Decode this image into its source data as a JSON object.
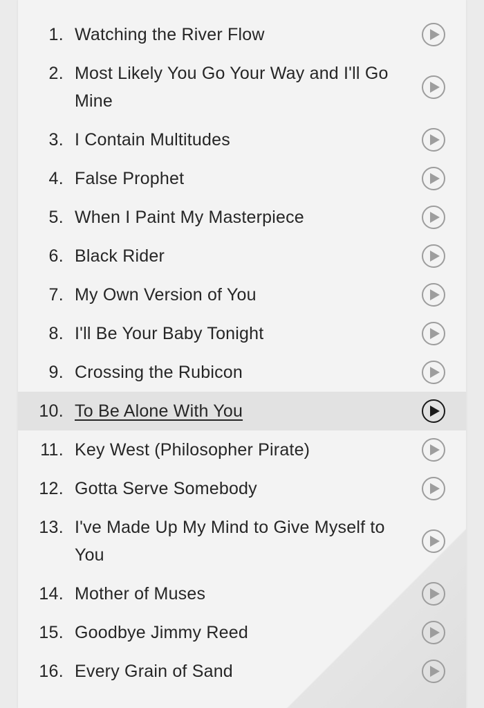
{
  "colors": {
    "background": "#ebebeb",
    "paper": "#f3f3f3",
    "text": "#262626",
    "highlight_row": "#e2e2e2",
    "play_icon_inactive": "#9d9d9d",
    "play_icon_active": "#1a1a1a"
  },
  "tracklist": {
    "active_index": 9,
    "tracks": [
      {
        "number": "1.",
        "title": "Watching the River Flow"
      },
      {
        "number": "2.",
        "title": "Most Likely You Go Your Way and I'll Go Mine"
      },
      {
        "number": "3.",
        "title": "I Contain Multitudes"
      },
      {
        "number": "4.",
        "title": "False Prophet"
      },
      {
        "number": "5.",
        "title": "When I Paint My Masterpiece"
      },
      {
        "number": "6.",
        "title": "Black Rider"
      },
      {
        "number": "7.",
        "title": "My Own Version of You"
      },
      {
        "number": "8.",
        "title": "I'll Be Your Baby Tonight"
      },
      {
        "number": "9.",
        "title": "Crossing the Rubicon"
      },
      {
        "number": "10.",
        "title": "To Be Alone With You"
      },
      {
        "number": "11.",
        "title": "Key West (Philosopher Pirate)"
      },
      {
        "number": "12.",
        "title": "Gotta Serve Somebody"
      },
      {
        "number": "13.",
        "title": "I've Made Up My Mind to Give Myself to You"
      },
      {
        "number": "14.",
        "title": "Mother of Muses"
      },
      {
        "number": "15.",
        "title": "Goodbye Jimmy Reed"
      },
      {
        "number": "16.",
        "title": "Every Grain of Sand"
      }
    ]
  }
}
